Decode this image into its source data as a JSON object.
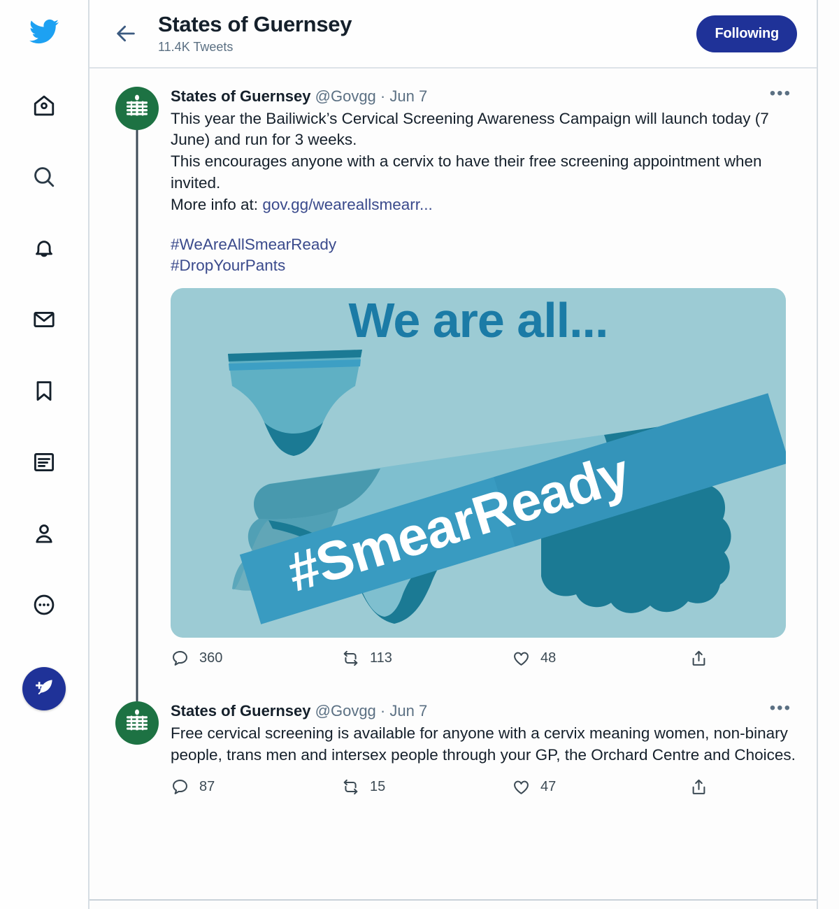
{
  "sidebar": {
    "items": [
      {
        "name": "twitter-logo",
        "label": "Twitter"
      },
      {
        "name": "home",
        "label": "Home"
      },
      {
        "name": "explore",
        "label": "Explore"
      },
      {
        "name": "notifications",
        "label": "Notifications"
      },
      {
        "name": "messages",
        "label": "Messages"
      },
      {
        "name": "bookmarks",
        "label": "Bookmarks"
      },
      {
        "name": "lists",
        "label": "Lists"
      },
      {
        "name": "profile",
        "label": "Profile"
      },
      {
        "name": "more",
        "label": "More"
      }
    ],
    "compose_label": "Tweet"
  },
  "header": {
    "back_label": "Back",
    "title": "States of Guernsey",
    "subtitle": "11.4K Tweets",
    "follow_button": "Following",
    "follow_button_color": "#1f3298"
  },
  "tweets": [
    {
      "display_name": "States of Guernsey",
      "handle": "@Govgg",
      "separator": "·",
      "date": "Jun 7",
      "more_glyph": "•••",
      "text_part_1": "This year the Bailiwick’s Cervical Screening Awareness Campaign will launch today (7 June) and run for 3 weeks.\nThis encourages anyone with a cervix to have their free screening appointment when invited.\nMore info at: ",
      "link_text": "gov.gg/weareallsmearr...",
      "hashtag_1": "#WeAreAllSmearReady",
      "hashtag_2": "#DropYourPants",
      "media": {
        "alt": "We are all... #SmearReady campaign graphic",
        "headline": "We are all...",
        "banner_text": "#SmearReady",
        "bg_color": "#9ccbd4",
        "headline_color": "#1b7ba6",
        "banner_color": "#3d9fc4"
      },
      "actions": {
        "reply_count": "360",
        "retweet_count": "113",
        "like_count": "48",
        "share_label": "Share"
      }
    },
    {
      "display_name": "States of Guernsey",
      "handle": "@Govgg",
      "separator": "·",
      "date": "Jun 7",
      "more_glyph": "•••",
      "text": "Free cervical screening is available for anyone with a cervix meaning women, non-binary people, trans men and intersex people through your GP, the Orchard Centre and Choices.",
      "actions": {
        "reply_count": "87",
        "retweet_count": "15",
        "like_count": "47",
        "share_label": "Share"
      }
    }
  ],
  "colors": {
    "twitter_blue": "#1da1f2",
    "avatar_green": "#1d7243",
    "text_primary": "#15202b",
    "text_secondary": "#5b7083",
    "link": "#3a4a8c"
  }
}
